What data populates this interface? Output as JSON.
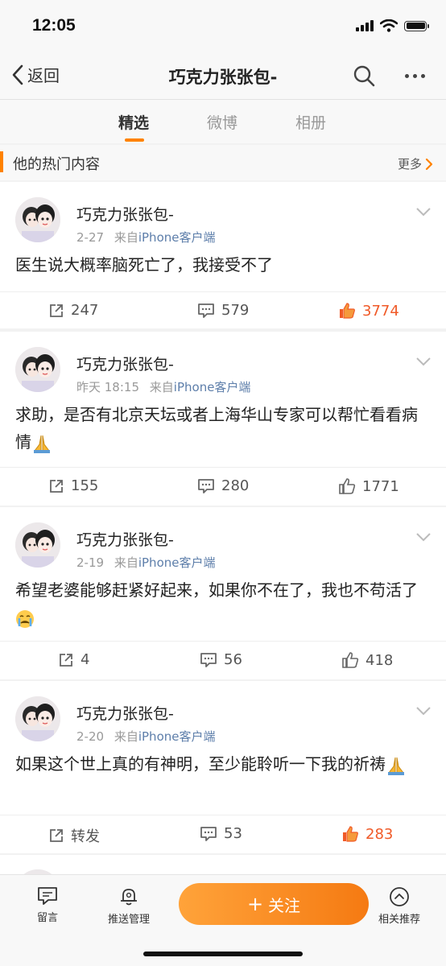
{
  "status": {
    "time": "12:05"
  },
  "nav": {
    "back_label": "返回",
    "title": "巧克力张张包-"
  },
  "tabs": [
    {
      "label": "精选",
      "active": true
    },
    {
      "label": "微博",
      "active": false
    },
    {
      "label": "相册",
      "active": false
    }
  ],
  "section": {
    "title": "他的热门内容",
    "more": "更多"
  },
  "posts": [
    {
      "user": "巧克力张张包-",
      "time": "2-27",
      "source_prefix": "来自",
      "source": "iPhone客户端",
      "text": "医生说大概率脑死亡了，我接受不了",
      "emoji": "",
      "repost": "247",
      "comments": "579",
      "likes": "3774",
      "liked": true
    },
    {
      "user": "巧克力张张包-",
      "time": "昨天 18:15",
      "source_prefix": "来自",
      "source": "iPhone客户端",
      "text": "求助，是否有北京天坛或者上海华山专家可以帮忙看看病情",
      "emoji": "pray-emoji",
      "repost": "155",
      "comments": "280",
      "likes": "1771",
      "liked": false
    },
    {
      "user": "巧克力张张包-",
      "time": "2-19",
      "source_prefix": "来自",
      "source": "iPhone客户端",
      "text": "希望老婆能够赶紧好起来，如果你不在了，我也不苟活了",
      "emoji": "crying-emoji",
      "repost": "4",
      "comments": "56",
      "likes": "418",
      "liked": false
    },
    {
      "user": "巧克力张张包-",
      "time": "2-20",
      "source_prefix": "来自",
      "source": "iPhone客户端",
      "text": "如果这个世上真的有神明，至少能聆听一下我的祈祷",
      "emoji": "pray-emoji",
      "repost": "转发",
      "comments": "53",
      "likes": "283",
      "liked": true
    }
  ],
  "bottom": {
    "message": "留言",
    "push": "推送管理",
    "follow": "关注",
    "follow_icon": "+",
    "related": "相关推荐"
  },
  "colors": {
    "accent": "#ff8200",
    "liked": "#f05a28",
    "source_link": "#5d7eaa"
  }
}
